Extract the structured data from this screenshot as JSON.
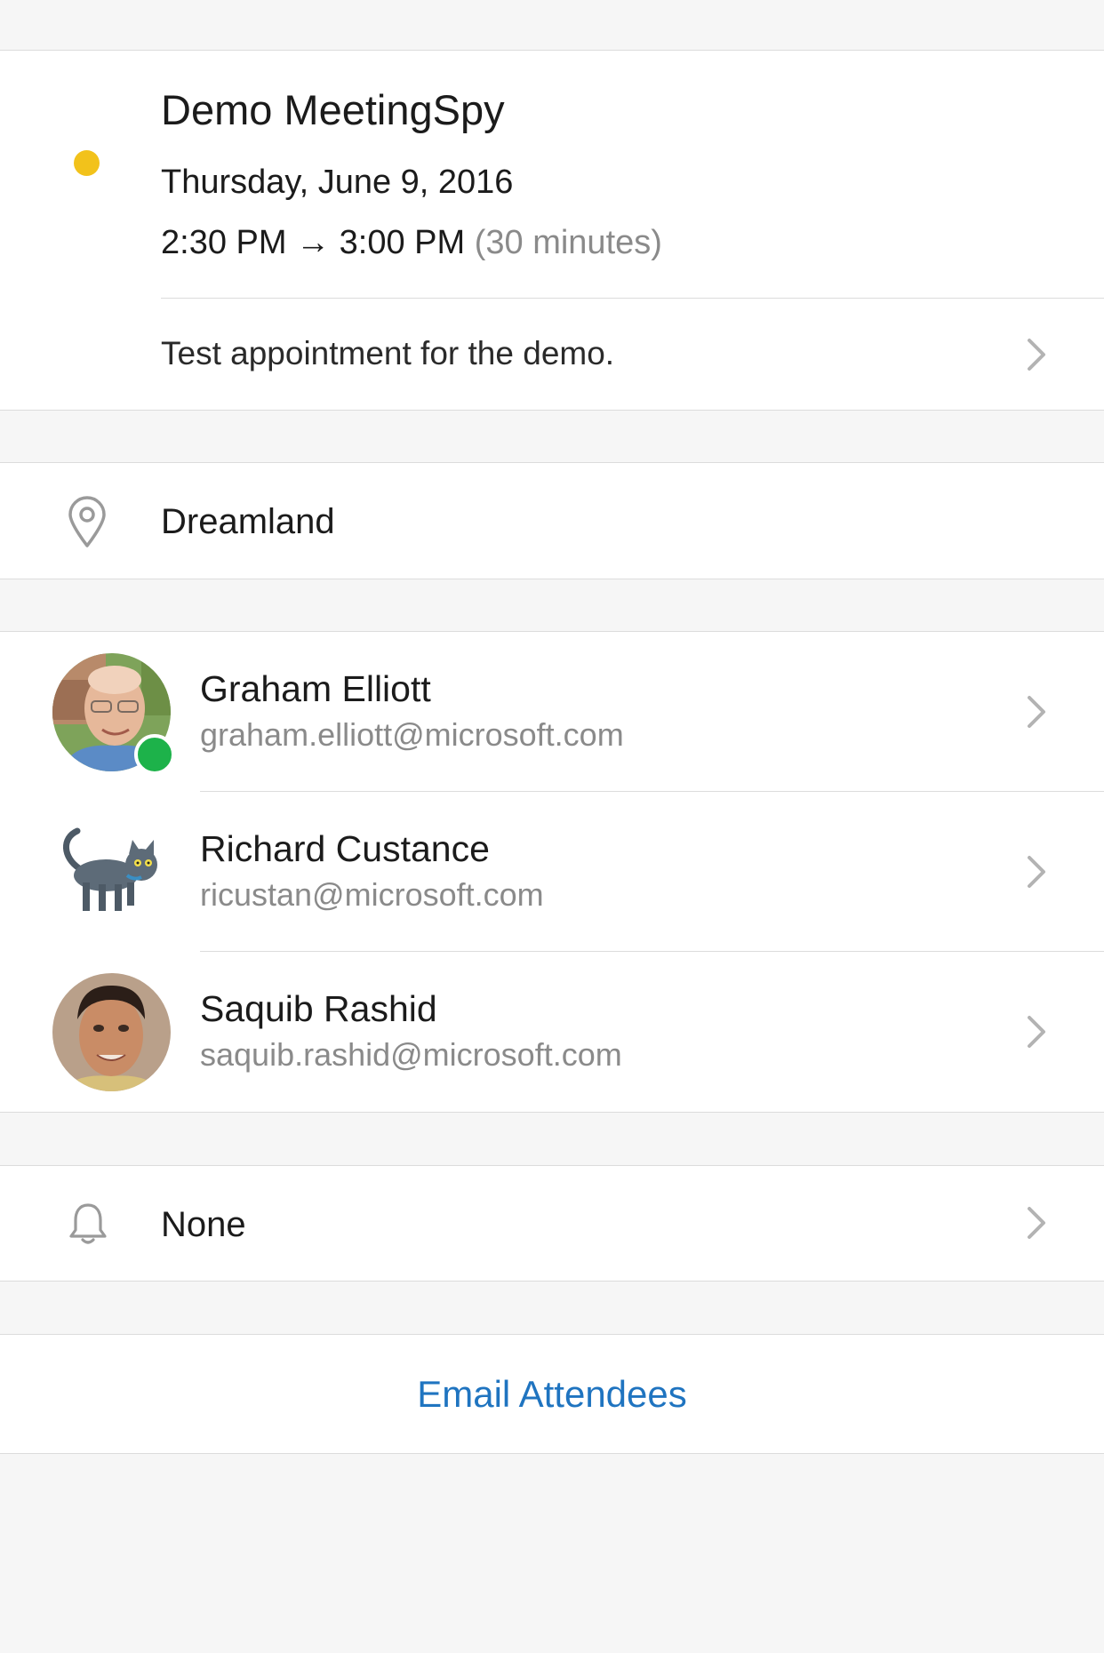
{
  "event": {
    "title": "Demo MeetingSpy",
    "calendar_color": "#f2c21b",
    "date": "Thursday, June 9, 2016",
    "time_range": "2:30 PM → 3:00 PM",
    "duration": "(30 minutes)",
    "notes": "Test appointment for the demo."
  },
  "location": {
    "icon": "location-pin-icon",
    "text": "Dreamland"
  },
  "attendees": [
    {
      "name": "Graham Elliott",
      "email": "graham.elliott@microsoft.com",
      "avatar": "photo-avatar",
      "presence": "available",
      "presence_color": "#1db24a"
    },
    {
      "name": "Richard Custance",
      "email": "ricustan@microsoft.com",
      "avatar": "cat-cartoon-avatar"
    },
    {
      "name": "Saquib Rashid",
      "email": "saquib.rashid@microsoft.com",
      "avatar": "photo-avatar"
    }
  ],
  "reminder": {
    "icon": "bell-icon",
    "value": "None"
  },
  "actions": {
    "email_attendees": "Email Attendees",
    "accent_color": "#1f74c0"
  }
}
